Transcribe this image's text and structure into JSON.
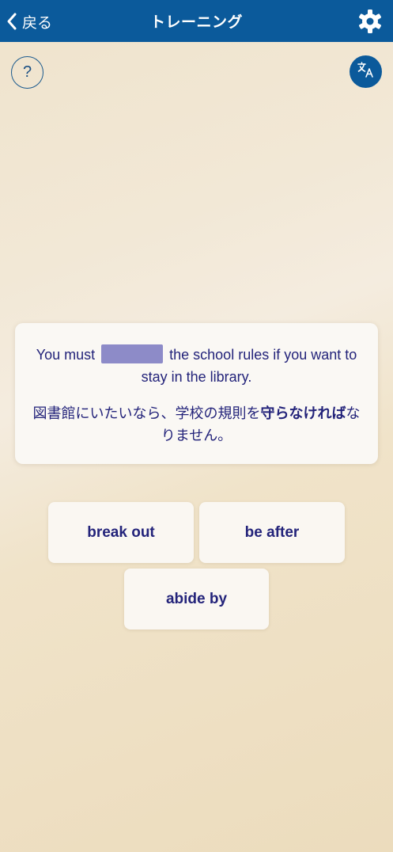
{
  "header": {
    "back_label": "戻る",
    "title": "トレーニング",
    "back_icon": "chevron-left-icon",
    "settings_icon": "gear-icon"
  },
  "toolbar": {
    "help_label": "?",
    "translate_icon": "translate-icon"
  },
  "question": {
    "en_before": "You must",
    "en_after": "the school rules if you want to stay in the library.",
    "jp_before": "図書館にいたいなら、学校の規則を",
    "jp_highlight": "守らなければ",
    "jp_after": "なりません。"
  },
  "choices": [
    {
      "label": "break out"
    },
    {
      "label": "be after"
    },
    {
      "label": "abide by"
    }
  ],
  "colors": {
    "header_bg": "#0b5a9b",
    "text": "#23237a",
    "blank": "#8d8bc8"
  }
}
